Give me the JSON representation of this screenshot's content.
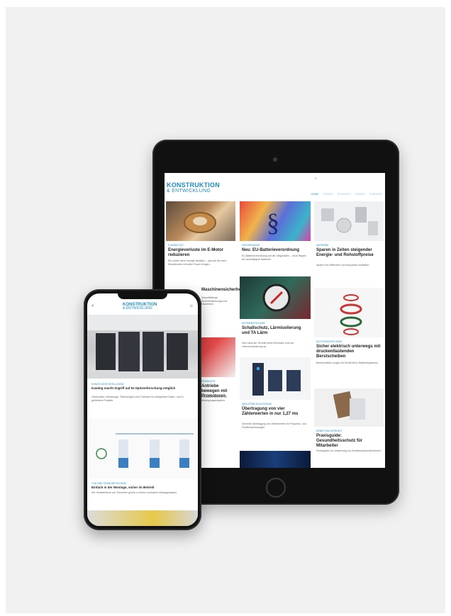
{
  "tablet": {
    "logo_line1": "KONSTRUKTION",
    "logo_line2": "& ENTWICKLUNG",
    "nav": [
      "HOME",
      "THEMEN",
      "PRODUKTE",
      "WISSEN",
      "KARRIERE"
    ],
    "cards": [
      {
        "category": "E-MOBILITÄT",
        "title": "Energieverluste im E-Motor reduzieren",
        "text": "Ein Vorteil mehr Energie behalten – das soll die neue Motortechnik mit voller Power bringen."
      },
      {
        "category": "VERORDNUNG",
        "title": "Neu: EU-Batterieverordnung",
        "text": "EU-Batterieverordnung auf der Zielgeraden – neue Regeln für nachhaltigere Batterien"
      },
      {
        "category": "ANTRIEBE",
        "title": "Sparen in Zeiten steigender Energie- und Rohstoffpreise",
        "text": "Sparen mit effizienten und kompakten Antrieben."
      },
      {
        "category": "ANTRIEBSTECHNIK",
        "title": "Schallschutz, Lärmisolierung und TA Lärm",
        "text": "Das Haus der Technik bietet Seminare rund um Lärmverminderung an."
      },
      {
        "category": "DICHTUNGSTECHNIK",
        "title": "Sicher elektrisch unterwegs mit druckentlastenden Berstscheiben",
        "text": "Berstscheiben sorgen für Sicherheit in Batteriesystemen."
      },
      {
        "category": "INDUSTRIE-ELEKTRONIK",
        "title": "Übertragung von vier Zählerwerten in nur 1,27 ms",
        "text": "Schnelle Übertragung von Zählerwerten für Frequenz- und Positionsmessungen."
      },
      {
        "category": "ARBEITSSICHERHEIT",
        "title": "Praxisguide: Gesundheitsschutz für Mitarbeiter",
        "text": "Praxisguide zur Umsetzung von Arbeitsschutzmaßnahmen."
      },
      {
        "category": "PRODUKTE",
        "title": "Antriebe bewegen mit Promotoren",
        "text": "Elektrische Antriebe für Bewegungsaufgaben."
      },
      {
        "category": "SICHERHEIT",
        "title": "Maschinensicherheit",
        "text": "Zukunftsfähige Sicherheitslösungen für Maschinen."
      }
    ]
  },
  "phone": {
    "logo_line1": "KONSTRUKTION",
    "logo_line2": "& ENTWICKLUNG",
    "articles": [
      {
        "category": "KÜNSTLICHE INTELLIGENZ",
        "title": "Katalog macht Zugriff auf KI-Spitzenforschung möglich",
        "text": "Infrastruktur, Werkzeuge, Technologien und Prozesse für erfolgreiche Daten- und KI-getriebene Projekte."
      },
      {
        "category": "TGA UND GEBÄUDETECHNIK",
        "title": "Einfach in der Montage, sicher im Betrieb",
        "text": "Der Verteilerblock von Schneider gehört zu einem modularen Montagesystem."
      }
    ]
  }
}
